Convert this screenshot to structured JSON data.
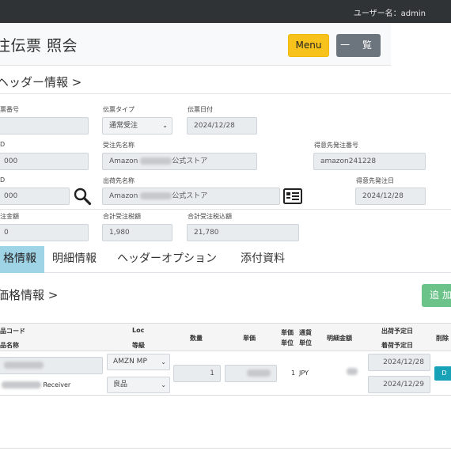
{
  "topbar": {
    "user_label": "ユーザー名：admin"
  },
  "titlebar": {
    "title": "注伝票 照会",
    "menu_label": "Menu",
    "list_label": "一 覧"
  },
  "header_section": {
    "heading": "ヘッダー情報 >"
  },
  "fields": {
    "slip_no": {
      "label": "票番号",
      "value": ""
    },
    "slip_type": {
      "label": "伝票タイプ",
      "value": "通常受注"
    },
    "slip_date": {
      "label": "伝票日付",
      "value": "2024/12/28"
    },
    "id1": {
      "label": "D",
      "value": "000"
    },
    "order_dest_name": {
      "label": "受注先名称",
      "value_prefix": "Amazon",
      "value_suffix": "公式ストア"
    },
    "customer_order_no": {
      "label": "得意先発注番号",
      "value": "amazon241228"
    },
    "id2": {
      "label": "D",
      "value": "000"
    },
    "ship_dest_name": {
      "label": "出荷先名称",
      "value_prefix": "Amazon",
      "value_suffix": "公式ストア"
    },
    "customer_order_date": {
      "label": "得意先発注日",
      "value": "2024/12/28"
    },
    "amount": {
      "label": "注金額",
      "value": "0"
    },
    "total_tax": {
      "label": "合計受注税額",
      "value": "1,980"
    },
    "total_incl_tax": {
      "label": "合計受注税込額",
      "value": "21,780"
    }
  },
  "tabs": [
    {
      "label": "格情報"
    },
    {
      "label": "明細情報"
    },
    {
      "label": "ヘッダーオプション"
    },
    {
      "label": "添付資料"
    }
  ],
  "price_section": {
    "heading": "価格情報 >",
    "add_label": "追 加"
  },
  "table": {
    "headers": {
      "product_code": "品コード",
      "product_name": "品名称",
      "loc": "Loc",
      "grade": "等級",
      "qty": "数量",
      "unit_price": "単価",
      "price_unit_1": "単価",
      "price_unit_2": "単位",
      "currency_1": "通貨",
      "currency_2": "単位",
      "line_amount": "明細金額",
      "ship_date": "出荷予定日",
      "arrival_date": "着荷予定日",
      "delete": "削除"
    },
    "row": {
      "product_name_suffix": "Receiver",
      "loc": "AMZN MP",
      "grade": "良品",
      "qty": "1",
      "unit_qty": "1",
      "currency": "JPY",
      "ship_date": "2024/12/28",
      "arrival_date": "2024/12/29",
      "delete_label": "D"
    }
  }
}
